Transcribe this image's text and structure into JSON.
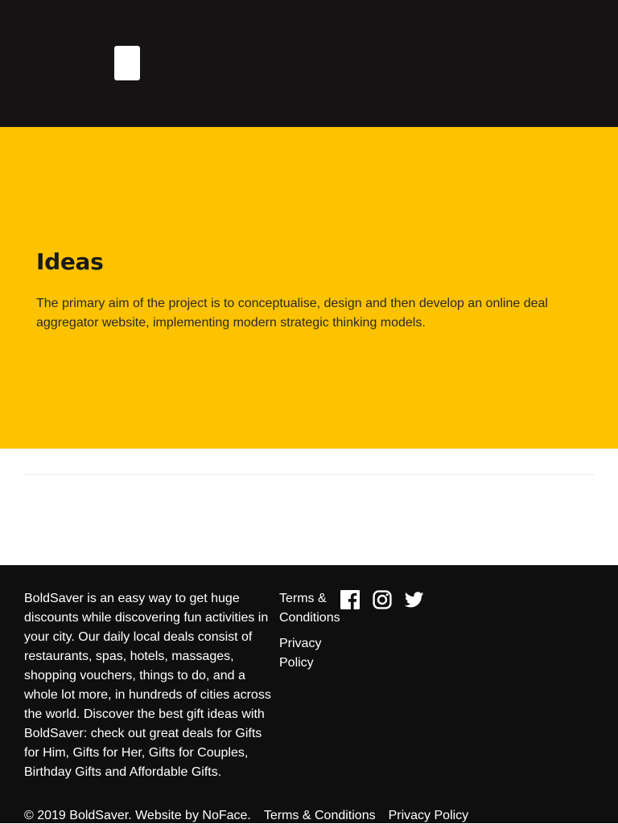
{
  "header": {
    "menu_button": "menu"
  },
  "hero": {
    "title": "Ideas",
    "body": "The primary aim of the project is to conceptualise, design and then develop an online deal aggregator website, implementing modern strategic thinking models."
  },
  "footer": {
    "about": "BoldSaver is an easy way to get huge discounts while discovering fun activities in your city. Our daily local deals consist of restaurants, spas, hotels, massages, shopping vouchers, things to do, and a whole lot more, in hundreds of cities across the world. Discover the best gift ideas with BoldSaver: check out great deals for Gifts for Him, Gifts for Her, Gifts for Couples, Birthday Gifts and Affordable Gifts.",
    "links": [
      {
        "label": "Terms & Conditions"
      },
      {
        "label": "Privacy Policy"
      }
    ],
    "social": [
      "facebook-icon",
      "instagram-icon",
      "twitter-icon"
    ],
    "bottom": {
      "copyright": "© 2019 BoldSaver. Website by NoFace.",
      "terms": "Terms & Conditions",
      "privacy": "Privacy Policy"
    }
  },
  "colors": {
    "header_bg": "#151314",
    "hero_bg": "#fdc300",
    "footer_bg": "#0f0f0f",
    "text_dark": "#1a1a1a",
    "text_light": "#ffffff"
  }
}
